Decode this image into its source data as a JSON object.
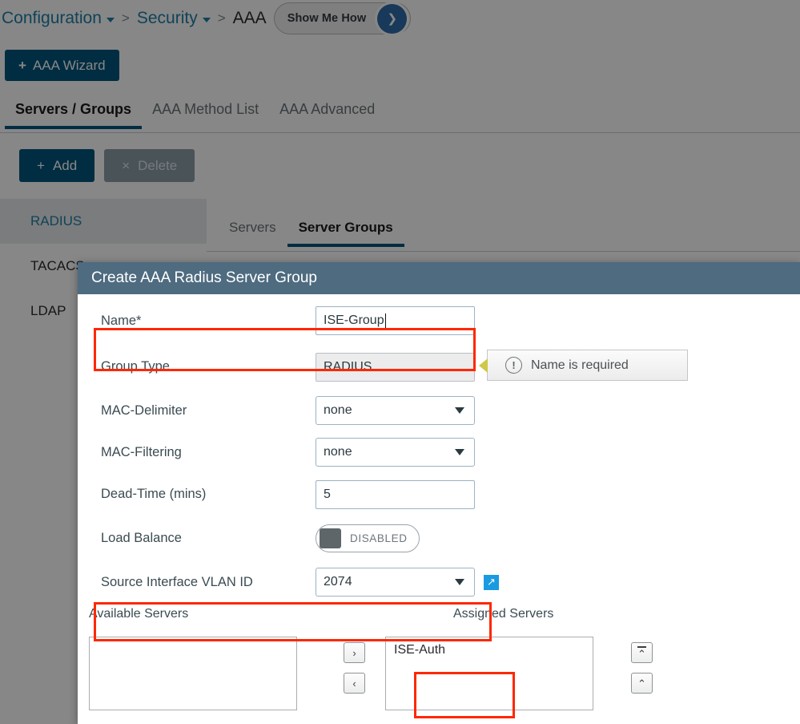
{
  "breadcrumb": {
    "items": [
      {
        "label": "Configuration",
        "type": "link-dropdown"
      },
      {
        "label": "Security",
        "type": "link-dropdown"
      },
      {
        "label": "AAA",
        "type": "current"
      }
    ],
    "separator": ">",
    "show_me_how": {
      "label": "Show Me How",
      "arrow_glyph": "❯",
      "circle_color": "#2f6ca8"
    }
  },
  "page": {
    "wizard_button": {
      "label": "AAA Wizard",
      "plus": "+"
    },
    "tabs": [
      {
        "label": "Servers / Groups",
        "active": true
      },
      {
        "label": "AAA Method List",
        "active": false
      },
      {
        "label": "AAA Advanced",
        "active": false
      }
    ],
    "toolbar": {
      "add_label": "Add",
      "add_plus": "+",
      "delete_label": "Delete",
      "delete_x": "×"
    },
    "left_list": [
      {
        "label": "RADIUS",
        "selected": true
      },
      {
        "label": "TACACS+",
        "selected": false
      },
      {
        "label": "LDAP",
        "selected": false
      }
    ],
    "inner_tabs": [
      {
        "label": "Servers",
        "active": false
      },
      {
        "label": "Server Groups",
        "active": true
      }
    ],
    "accent_color": "#00567d"
  },
  "dialog": {
    "title": "Create AAA Radius Server Group",
    "header_color": "#4e6b80",
    "fields": {
      "name": {
        "label": "Name*",
        "value": "ISE-Group",
        "highlighted": true
      },
      "group_type": {
        "label": "Group Type",
        "value": "RADIUS",
        "readonly": true
      },
      "mac_delimiter": {
        "label": "MAC-Delimiter",
        "value": "none"
      },
      "mac_filtering": {
        "label": "MAC-Filtering",
        "value": "none"
      },
      "dead_time": {
        "label": "Dead-Time (mins)",
        "value": "5"
      },
      "load_balance": {
        "label": "Load Balance",
        "state": "DISABLED"
      },
      "source_interface_vlan_id": {
        "label": "Source Interface VLAN ID",
        "value": "2074",
        "highlighted": true,
        "external_icon": "↗"
      }
    },
    "tooltip": {
      "message": "Name is required",
      "icon": "!"
    },
    "transfer": {
      "available_heading": "Available Servers",
      "assigned_heading": "Assigned Servers",
      "available_items": [],
      "assigned_items": [
        "ISE-Auth"
      ],
      "move_right_glyph": "›",
      "move_left_glyph": "‹",
      "move_top_glyph": "⌃",
      "move_up_glyph": "⌃"
    },
    "annotation_color": "#fe2800"
  }
}
